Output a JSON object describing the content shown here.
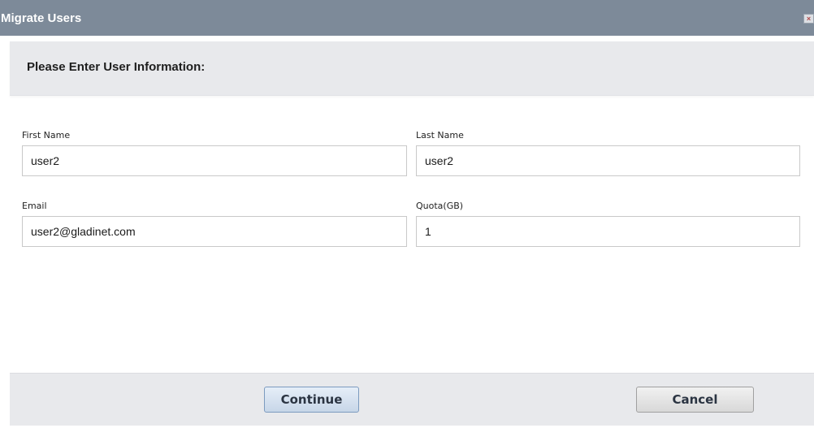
{
  "dialog": {
    "title": "Migrate Users",
    "close_glyph": "×",
    "close_icon": "close-icon"
  },
  "header": {
    "text": "Please Enter User Information:"
  },
  "form": {
    "first_name_label": "First Name",
    "first_name_value": "user2",
    "last_name_label": "Last Name",
    "last_name_value": "user2",
    "email_label": "Email",
    "email_value": "user2@gladinet.com",
    "quota_label": "Quota(GB)",
    "quota_value": "1"
  },
  "footer": {
    "continue_label": "Continue",
    "cancel_label": "Cancel"
  },
  "colors": {
    "title_bar": "#7d8a99",
    "panel_gray": "#e8e9ec",
    "continue_button": "#c7d6e8"
  }
}
